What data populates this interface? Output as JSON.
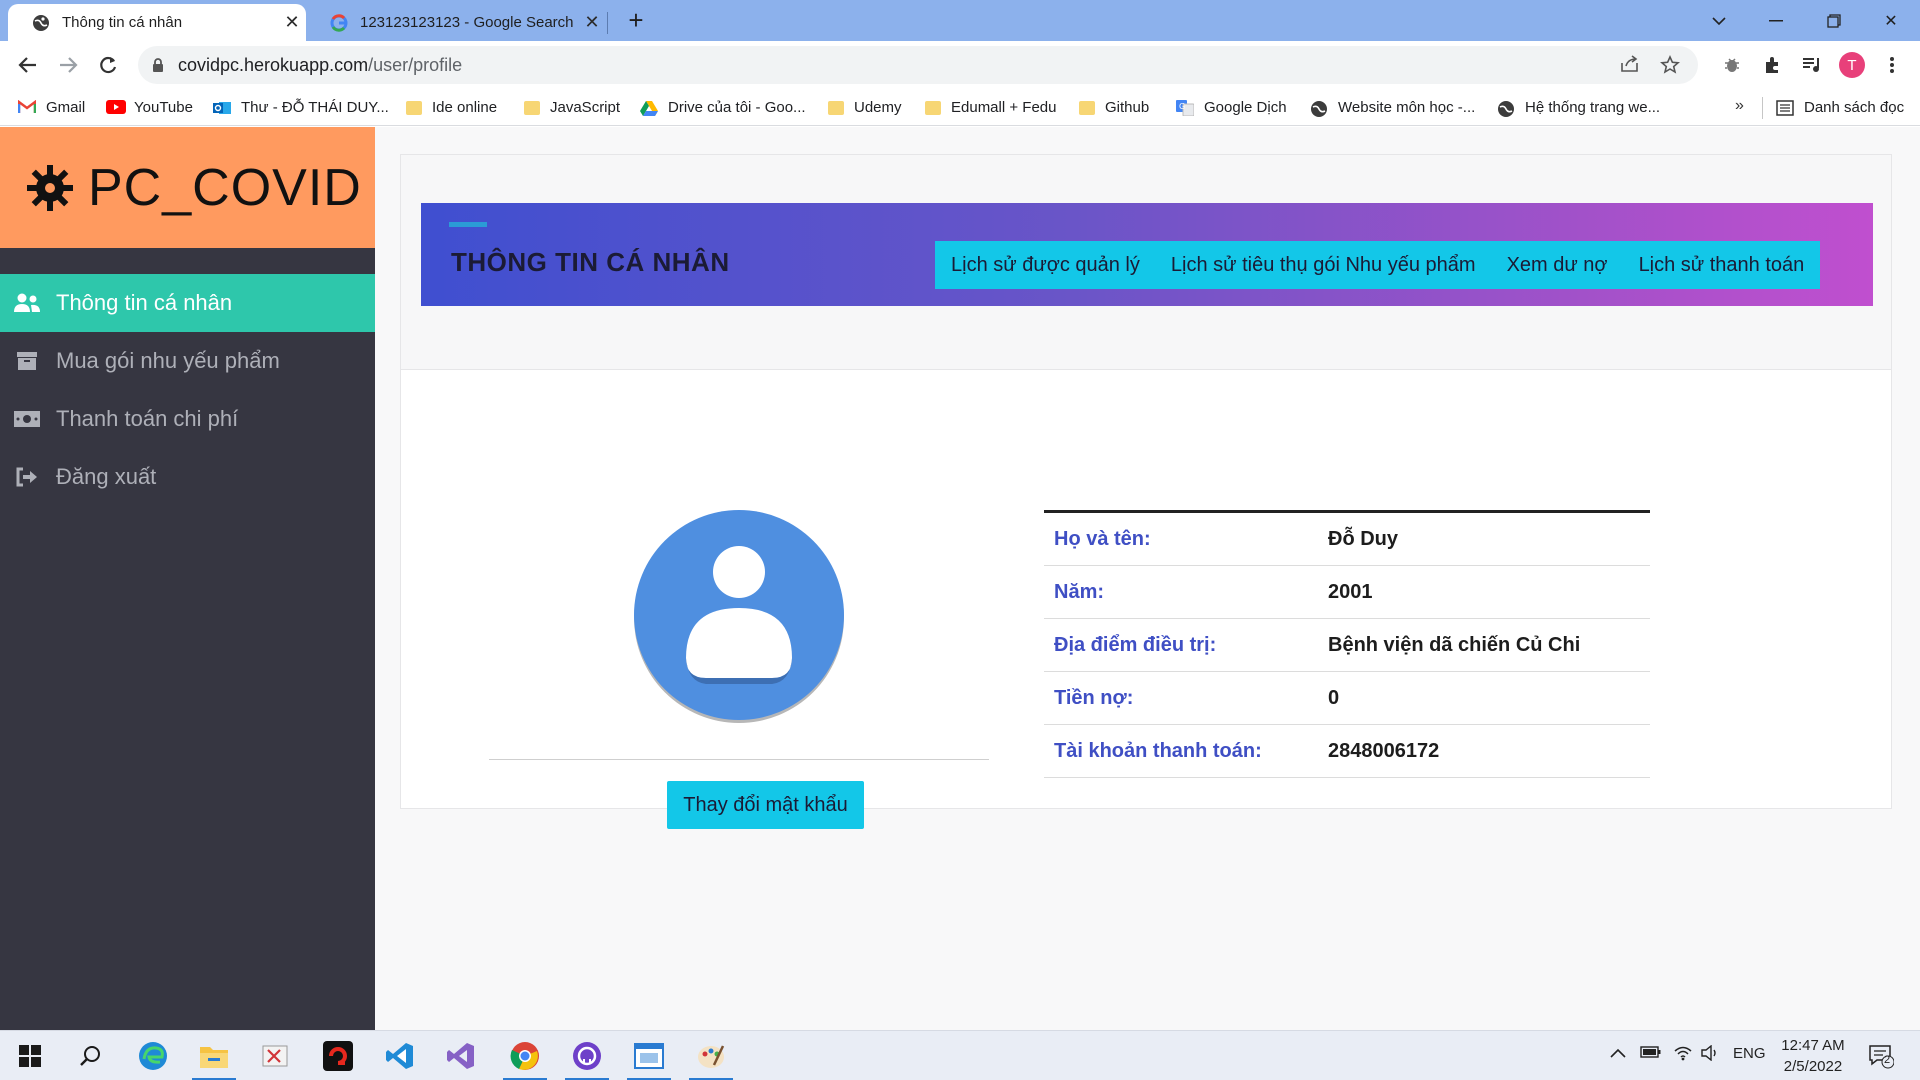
{
  "browser": {
    "tabs": [
      {
        "title": "Thông tin cá nhân",
        "active": true
      },
      {
        "title": "123123123123 - Google Search",
        "active": false
      }
    ],
    "url_host": "covidpc.herokuapp.com",
    "url_path": "/user/profile",
    "profile_initial": "T",
    "bookmarks": [
      {
        "label": "Gmail",
        "icon": "gmail-icon"
      },
      {
        "label": "YouTube",
        "icon": "youtube-icon"
      },
      {
        "label": "Thư - ĐỖ THÁI DUY...",
        "icon": "outlook-icon"
      },
      {
        "label": "Ide online",
        "icon": "folder-icon"
      },
      {
        "label": "JavaScript",
        "icon": "folder-icon"
      },
      {
        "label": "Drive của tôi - Goo...",
        "icon": "drive-icon"
      },
      {
        "label": "Udemy",
        "icon": "folder-icon"
      },
      {
        "label": "Edumall + Fedu",
        "icon": "folder-icon"
      },
      {
        "label": "Github",
        "icon": "folder-icon"
      },
      {
        "label": "Google Dịch",
        "icon": "translate-icon"
      },
      {
        "label": "Website môn học -...",
        "icon": "globe-icon"
      },
      {
        "label": "Hệ thống trang we...",
        "icon": "globe-icon"
      }
    ],
    "bookmarks_more": "»",
    "reading_list": "Danh sách đọc"
  },
  "app": {
    "brand": "PC_COVID",
    "menu": [
      {
        "label": "Thông tin cá nhân",
        "icon": "users-icon",
        "active": true
      },
      {
        "label": "Mua gói nhu yếu phẩm",
        "icon": "archive-icon",
        "active": false
      },
      {
        "label": "Thanh toán chi phí",
        "icon": "money-icon",
        "active": false
      },
      {
        "label": "Đăng xuất",
        "icon": "sign-out-icon",
        "active": false
      }
    ],
    "page_title": "THÔNG TIN CÁ NHÂN",
    "header_tabs": [
      "Lịch sử được quản lý",
      "Lịch sử tiêu thụ gói Nhu yếu phẩm",
      "Xem dư nợ",
      "Lịch sử thanh toán"
    ],
    "change_password": "Thay đổi mật khẩu",
    "profile": [
      {
        "label": "Họ và tên:",
        "value": "Đỗ Duy"
      },
      {
        "label": "Năm:",
        "value": "2001"
      },
      {
        "label": "Địa điểm điều trị:",
        "value": "Bệnh viện dã chiến Củ Chi"
      },
      {
        "label": "Tiền nợ:",
        "value": "0"
      },
      {
        "label": "Tài khoản thanh toán:",
        "value": "2848006172"
      }
    ],
    "colors": {
      "brand_bg": "#ff9a5f",
      "sidebar_bg": "#363641",
      "active_menu": "#2ec7ab",
      "accent_button": "#13c7e8",
      "label_blue": "#3f4fc4"
    }
  },
  "taskbar": {
    "language": "ENG",
    "time": "12:47 AM",
    "date": "2/5/2022",
    "notifications": "2"
  }
}
